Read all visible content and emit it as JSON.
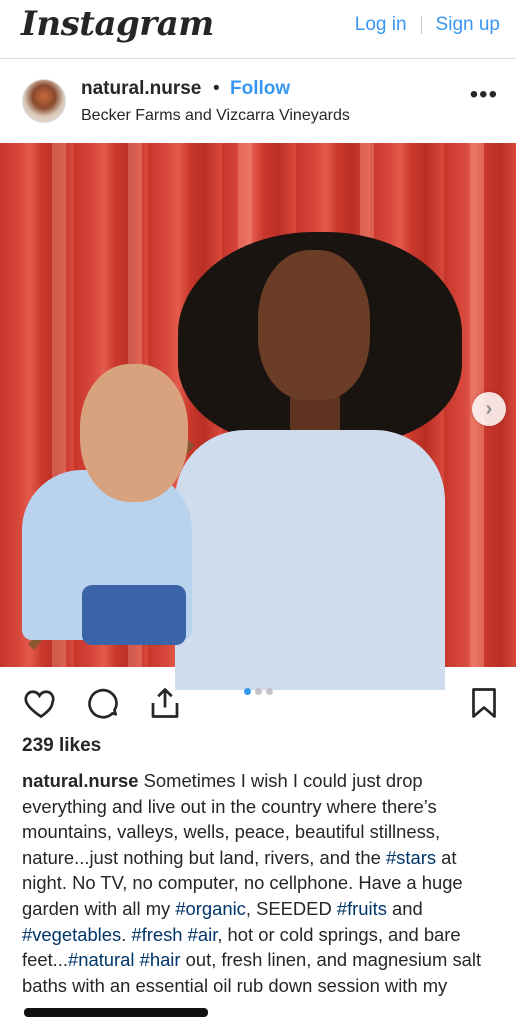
{
  "header": {
    "logo": "Instagram",
    "login_label": "Log in",
    "signup_label": "Sign up"
  },
  "post": {
    "username": "natural.nurse",
    "separator": "•",
    "follow_label": "Follow",
    "location": "Becker Farms and Vizcarra Vineyards",
    "more_label": "•••"
  },
  "carousel": {
    "next_label": "›",
    "current": 1,
    "total": 3
  },
  "likes_text": "239 likes",
  "caption": {
    "user": "natural.nurse",
    "seg1": " Sometimes I wish I could just drop everything and live out in the country where there’s mountains, valleys, wells, peace, beautiful stillness, nature...just nothing but land, rivers, and the ",
    "tag_stars": "#stars",
    "seg2": " at night. No TV, no computer, no cellphone. Have a huge garden with all my ",
    "tag_organic": "#organic",
    "seg3": ", SEEDED ",
    "tag_fruits": "#fruits",
    "seg4": " and ",
    "tag_vegetables": "#vegetables",
    "seg5": ". ",
    "tag_fresh": "#fresh",
    "seg6": " ",
    "tag_air": "#air",
    "seg7": ", hot or cold springs, and bare feet...",
    "tag_natural": "#natural",
    "seg8": " ",
    "tag_hair": "#hair",
    "seg9": " out, fresh linen, and magnesium salt baths with an essential oil rub down session with my"
  },
  "icons": {
    "like": "heart-icon",
    "comment": "comment-icon",
    "share": "share-icon",
    "save": "bookmark-icon",
    "more": "more-horizontal-icon",
    "next": "chevron-right-icon"
  },
  "colors": {
    "link_blue": "#3897f0",
    "hashtag": "#003569",
    "text": "#262626"
  }
}
